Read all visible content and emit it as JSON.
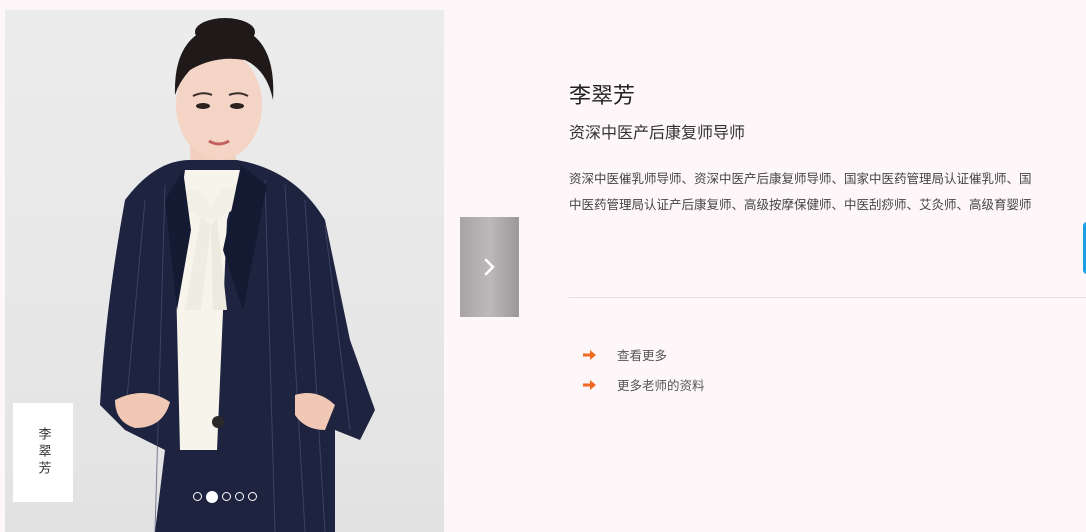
{
  "photo": {
    "name_card": "李翠芳",
    "slides": 5,
    "active_slide": 2
  },
  "teacher": {
    "name": "李翠芳",
    "title": "资深中医产后康复师导师",
    "desc_line1": "资深中医催乳师导师、资深中医产后康复师导师、国家中医药管理局认证催乳师、国",
    "desc_line2": "中医药管理局认证产后康复师、高级按摩保健师、中医刮痧师、艾灸师、高级育婴师"
  },
  "links": {
    "more": "查看更多",
    "more_teachers": "更多老师的资料"
  },
  "colors": {
    "arrow": "#f06a23",
    "accent_tab": "#1d9fe0",
    "background": "#fdf7f9"
  }
}
